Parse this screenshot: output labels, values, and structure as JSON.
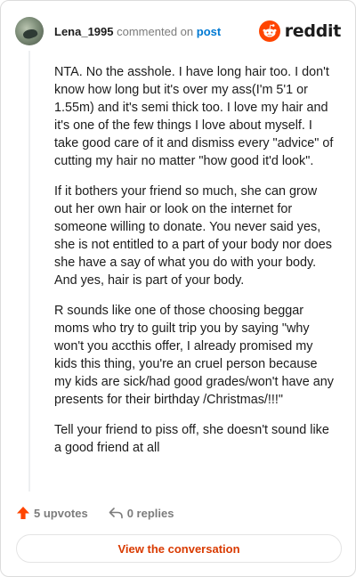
{
  "header": {
    "username": "Lena_1995",
    "action_text": "commented on",
    "post_link": "post",
    "brand": "reddit"
  },
  "comment": {
    "paragraphs": [
      "NTA. No the asshole. I have long hair too. I don't know how long but it's over my ass(I'm 5'1 or 1.55m) and it's semi thick too. I love my hair and it's one of the few things I love about myself. I take good care of it and dismiss every \"advice\" of cutting my hair no matter \"how good it'd look\".",
      "If it bothers your friend so much, she can grow out her own hair or look on the internet for someone willing to donate. You never said yes, she is not entitled to a part of your body nor does she have a say of what you do with your body. And yes, hair is part of your body.",
      "R sounds like one of those choosing beggar moms who try to guilt trip you by saying \"why won't you accthis offer, I already promised my kids this thing, you're an cruel person because my kids are sick/had good grades/won't have any presents for their birthday /Christmas/!!!\"",
      "Tell your friend to piss off, she doesn't sound like a good friend at all"
    ]
  },
  "actions": {
    "upvotes": "5 upvotes",
    "replies": "0 replies"
  },
  "footer": {
    "view_button": "View the conversation"
  },
  "colors": {
    "accent": "#ff4500",
    "link": "#0079d3",
    "button_text": "#d93a00"
  },
  "icons": {
    "avatar": "user-avatar",
    "logo": "reddit-snoo-icon",
    "upvote": "upvote-arrow-icon",
    "reply": "reply-arrow-icon"
  }
}
